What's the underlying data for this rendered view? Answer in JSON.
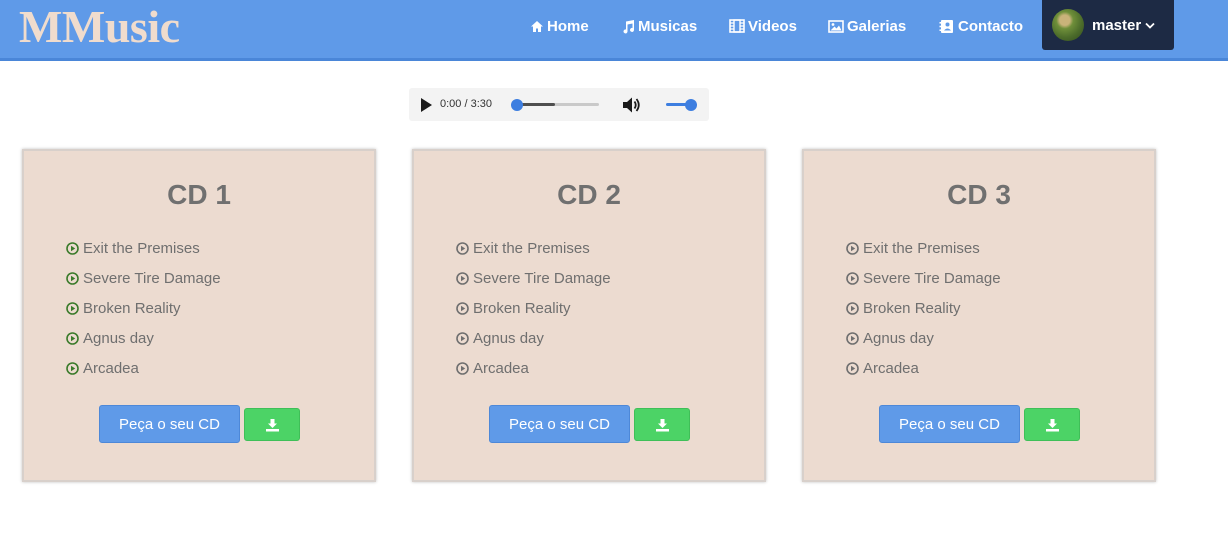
{
  "brand": "MMusic",
  "nav": {
    "home": "Home",
    "musicas": "Musicas",
    "videos": "Videos",
    "galerias": "Galerias",
    "contacto": "Contacto",
    "user": "master"
  },
  "player": {
    "time": "0:00 / 3:30",
    "progress": 0,
    "volume": 1
  },
  "cards": [
    {
      "title": "CD 1",
      "tracks": [
        "Exit the Premises",
        "Severe Tire Damage",
        "Broken Reality",
        "Agnus day",
        "Arcadea"
      ],
      "order_label": "Peça o seu CD"
    },
    {
      "title": "CD 2",
      "tracks": [
        "Exit the Premises",
        "Severe Tire Damage",
        "Broken Reality",
        "Agnus day",
        "Arcadea"
      ],
      "order_label": "Peça o seu CD"
    },
    {
      "title": "CD 3",
      "tracks": [
        "Exit the Premises",
        "Severe Tire Damage",
        "Broken Reality",
        "Agnus day",
        "Arcadea"
      ],
      "order_label": "Peça o seu CD"
    }
  ],
  "icons": {
    "home": "home-icon",
    "musicas": "music-note-icon",
    "videos": "film-icon",
    "galerias": "image-icon",
    "contacto": "address-book-icon",
    "chevron": "chevron-down-icon",
    "track": "play-circle-icon",
    "download": "download-icon"
  },
  "colors": {
    "navbar": "#5f9ae8",
    "brand": "#f0dccd",
    "user_box": "#1d2a44",
    "card_bg": "#ecdbd0",
    "order_button": "#5f9ae8",
    "download_button": "#4cd366",
    "play_icon_card1": "#3a7a2a",
    "play_icon": "#6f6f6f",
    "player_accent": "#3d7ee0"
  }
}
